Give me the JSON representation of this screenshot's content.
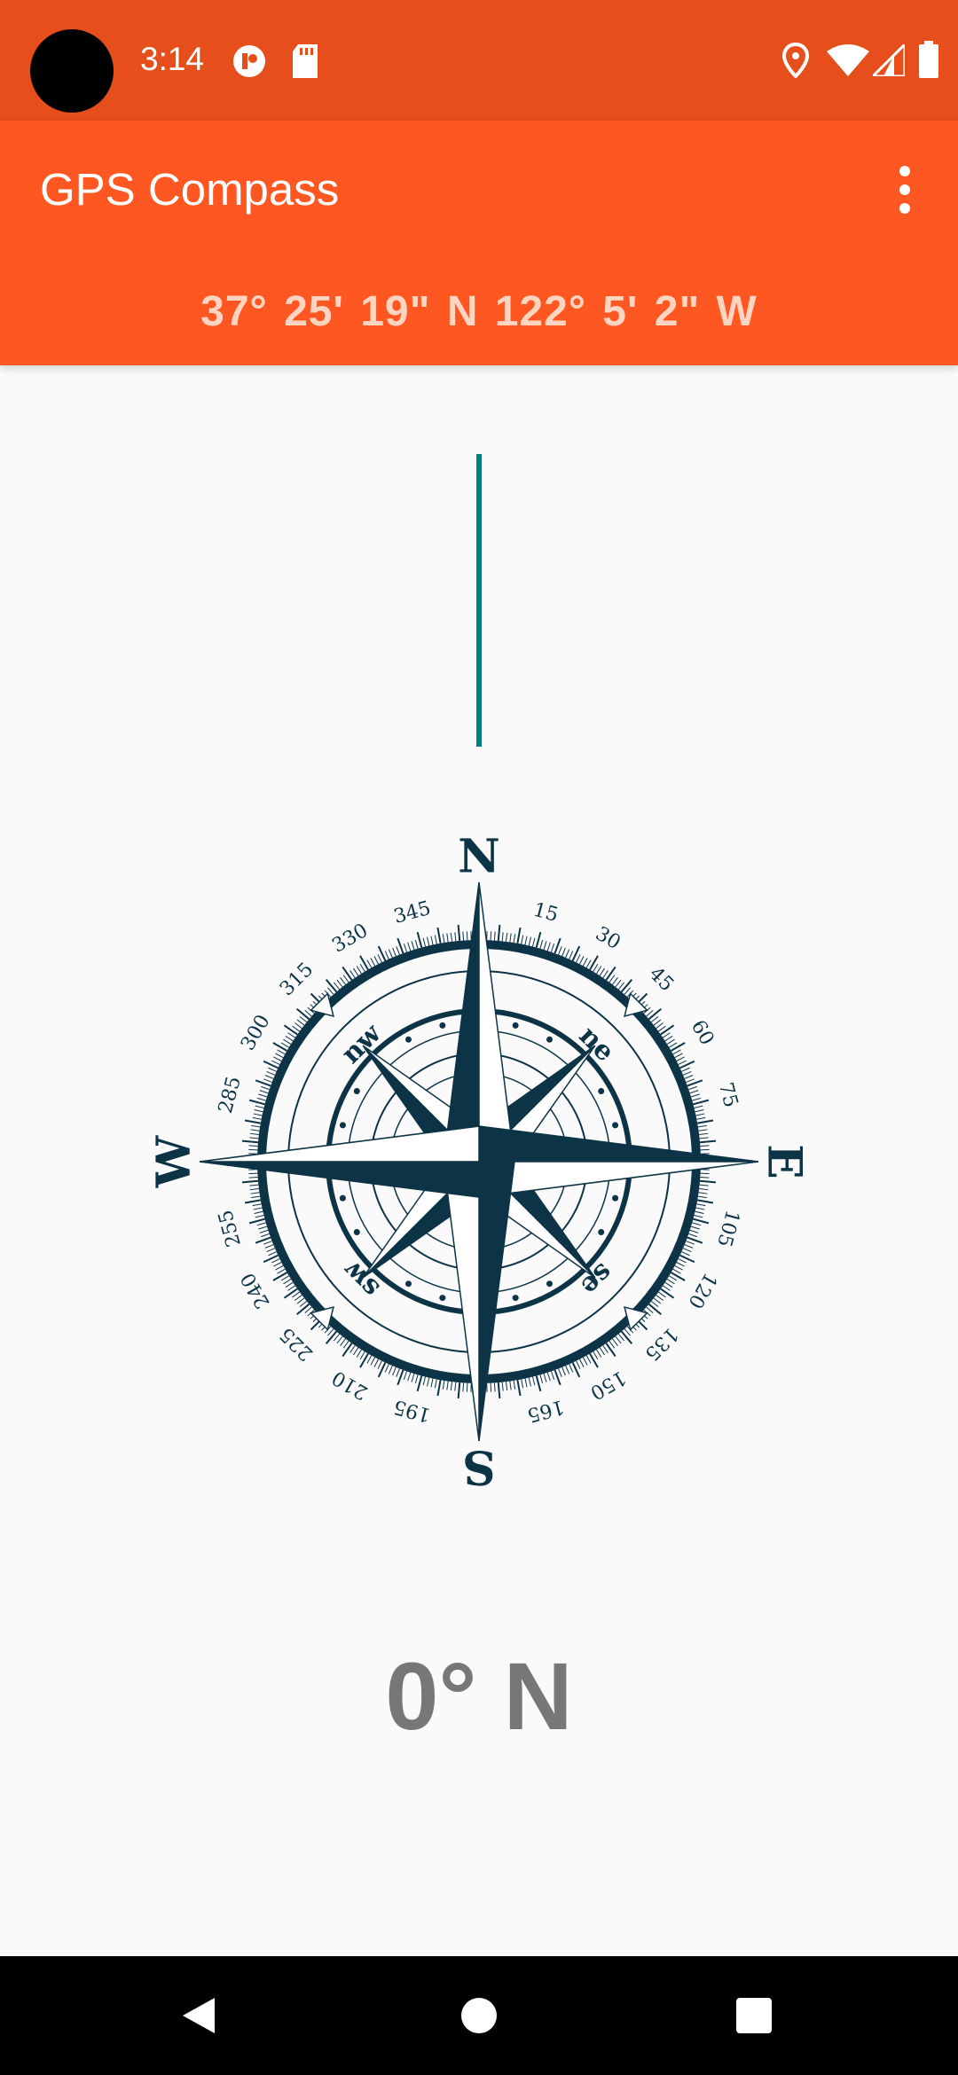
{
  "status_bar": {
    "time": "3:14",
    "icons": [
      "notification-icon",
      "sd-card-icon",
      "location-icon",
      "wifi-icon",
      "signal-icon",
      "battery-icon"
    ]
  },
  "app_bar": {
    "title": "GPS Compass",
    "coordinates": "37° 25' 19\" N  122° 5' 2\" W",
    "menu_icon": "more-vert-icon"
  },
  "compass": {
    "cardinals": [
      "N",
      "E",
      "S",
      "W"
    ],
    "intercardinals": [
      "ne",
      "se",
      "sw",
      "nw"
    ],
    "degree_labels": [
      "15",
      "30",
      "45",
      "60",
      "75",
      "105",
      "120",
      "135",
      "150",
      "165",
      "195",
      "210",
      "225",
      "240",
      "255",
      "285",
      "300",
      "315",
      "330",
      "345"
    ],
    "colors": {
      "rose": "#0d3446",
      "needle": "#008080"
    }
  },
  "heading": "0° N",
  "nav_bar": {
    "icons": [
      "back-icon",
      "home-icon",
      "recents-icon"
    ]
  }
}
